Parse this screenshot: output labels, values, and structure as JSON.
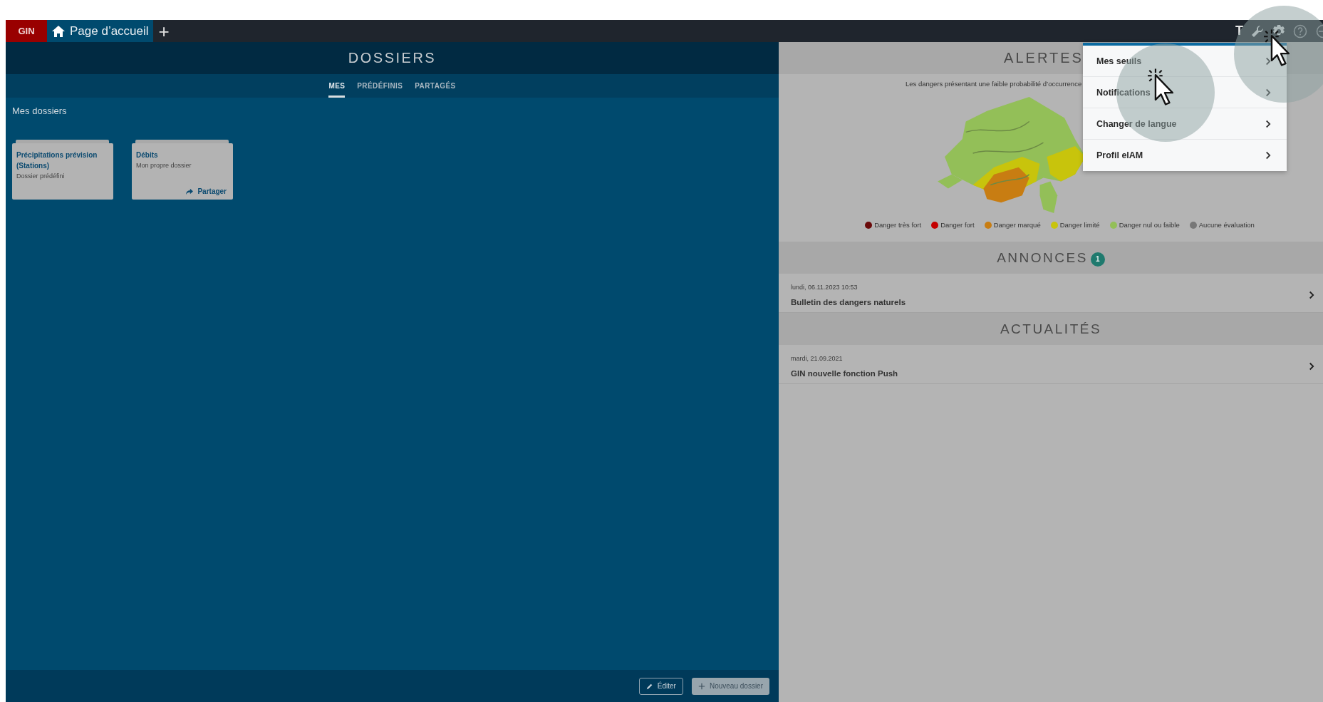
{
  "top_bar": {
    "logo": "GIN",
    "tabs": [
      {
        "label": "Page d’accueil",
        "selected": true
      }
    ],
    "add_label": "+",
    "text_tool": "T"
  },
  "dossiers": {
    "title": "DOSSIERS",
    "tabs": [
      {
        "label": "MES",
        "selected": true
      },
      {
        "label": "PRÉDÉFINIS",
        "selected": false
      },
      {
        "label": "PARTAGÉS",
        "selected": false
      }
    ],
    "section_title": "Mes dossiers",
    "cards": [
      {
        "title": "Précipitations prévision (Stations)",
        "subtitle": "Dossier prédéfini"
      },
      {
        "title": "Débits",
        "subtitle": "Mon propre dossier",
        "share_label": "Partager"
      }
    ],
    "footer_buttons": [
      {
        "kind": "outline",
        "label": "Éditer"
      },
      {
        "kind": "filled",
        "label": "Nouveau dossier"
      }
    ]
  },
  "alertes": {
    "title": "ALERTES",
    "note": "Les dangers présentant une faible probabilité d’occurrence",
    "legend": [
      {
        "label": "Danger très fort",
        "color": "#6a0a0a"
      },
      {
        "label": "Danger fort",
        "color": "#c40000"
      },
      {
        "label": "Danger marqué",
        "color": "#c87d12"
      },
      {
        "label": "Danger limité",
        "color": "#c8c40c"
      },
      {
        "label": "Danger nul ou faible",
        "color": "#93bf58"
      },
      {
        "label": "Aucune évaluation",
        "color": "#777777"
      }
    ]
  },
  "annonces": {
    "title": "ANNONCES",
    "badge": "1",
    "items": [
      {
        "date": "lundi, 06.11.2023 10:53",
        "title": "Bulletin des dangers naturels"
      }
    ]
  },
  "actualites": {
    "title": "ACTUALITÉS",
    "items": [
      {
        "date": "mardi, 21.09.2021",
        "title": "GIN nouvelle fonction Push"
      }
    ]
  },
  "settings_menu": {
    "items": [
      {
        "label": "Mes seuils"
      },
      {
        "label": "Notifications"
      },
      {
        "label": "Changer de langue"
      },
      {
        "label": "Profil elAM"
      }
    ]
  }
}
